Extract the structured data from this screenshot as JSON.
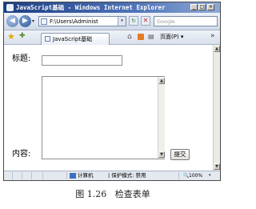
{
  "window": {
    "title": "JavaScript基础 - Windows Internet Explorer",
    "min_glyph": "_",
    "max_glyph": "□",
    "close_glyph": "×"
  },
  "address_bar": {
    "back_glyph": "◀",
    "forward_glyph": "▶",
    "history_glyph": "▾",
    "url": "F:\\Users\\Administ",
    "dropdown_glyph": "▾",
    "refresh_glyph": "↻",
    "stop_glyph": "✕",
    "search_placeholder": "Google"
  },
  "tab_bar": {
    "favorites_glyph": "★",
    "add_favorite_glyph": "✚",
    "tab_label": "JavaScript基础",
    "home_glyph": "⌂",
    "print_glyph": "▤",
    "page_menu": "页面(P) ▾",
    "overflow_glyph": "»"
  },
  "form": {
    "title_label": "标题:",
    "title_value": "",
    "content_label": "内容:",
    "content_value": "",
    "submit_label": "提交"
  },
  "scroll": {
    "up_glyph": "▲",
    "down_glyph": "▼"
  },
  "status_bar": {
    "zone": "计算机",
    "protected_mode": "| 保护模式: 禁用",
    "zoom": "100%",
    "zoom_dropdown_glyph": "▾"
  },
  "caption": "图 1.26   检查表单",
  "colors": {
    "title_bar": "#1c3e84",
    "chrome": "#d4d0c8",
    "content_bg": "#ffffff"
  },
  "icons": [
    "app-icon",
    "back-icon",
    "forward-icon",
    "page-icon",
    "refresh-icon",
    "stop-icon",
    "favorites-star-icon",
    "add-favorite-icon",
    "home-icon",
    "feed-icon",
    "print-icon",
    "computer-zone-icon",
    "zoom-icon"
  ]
}
